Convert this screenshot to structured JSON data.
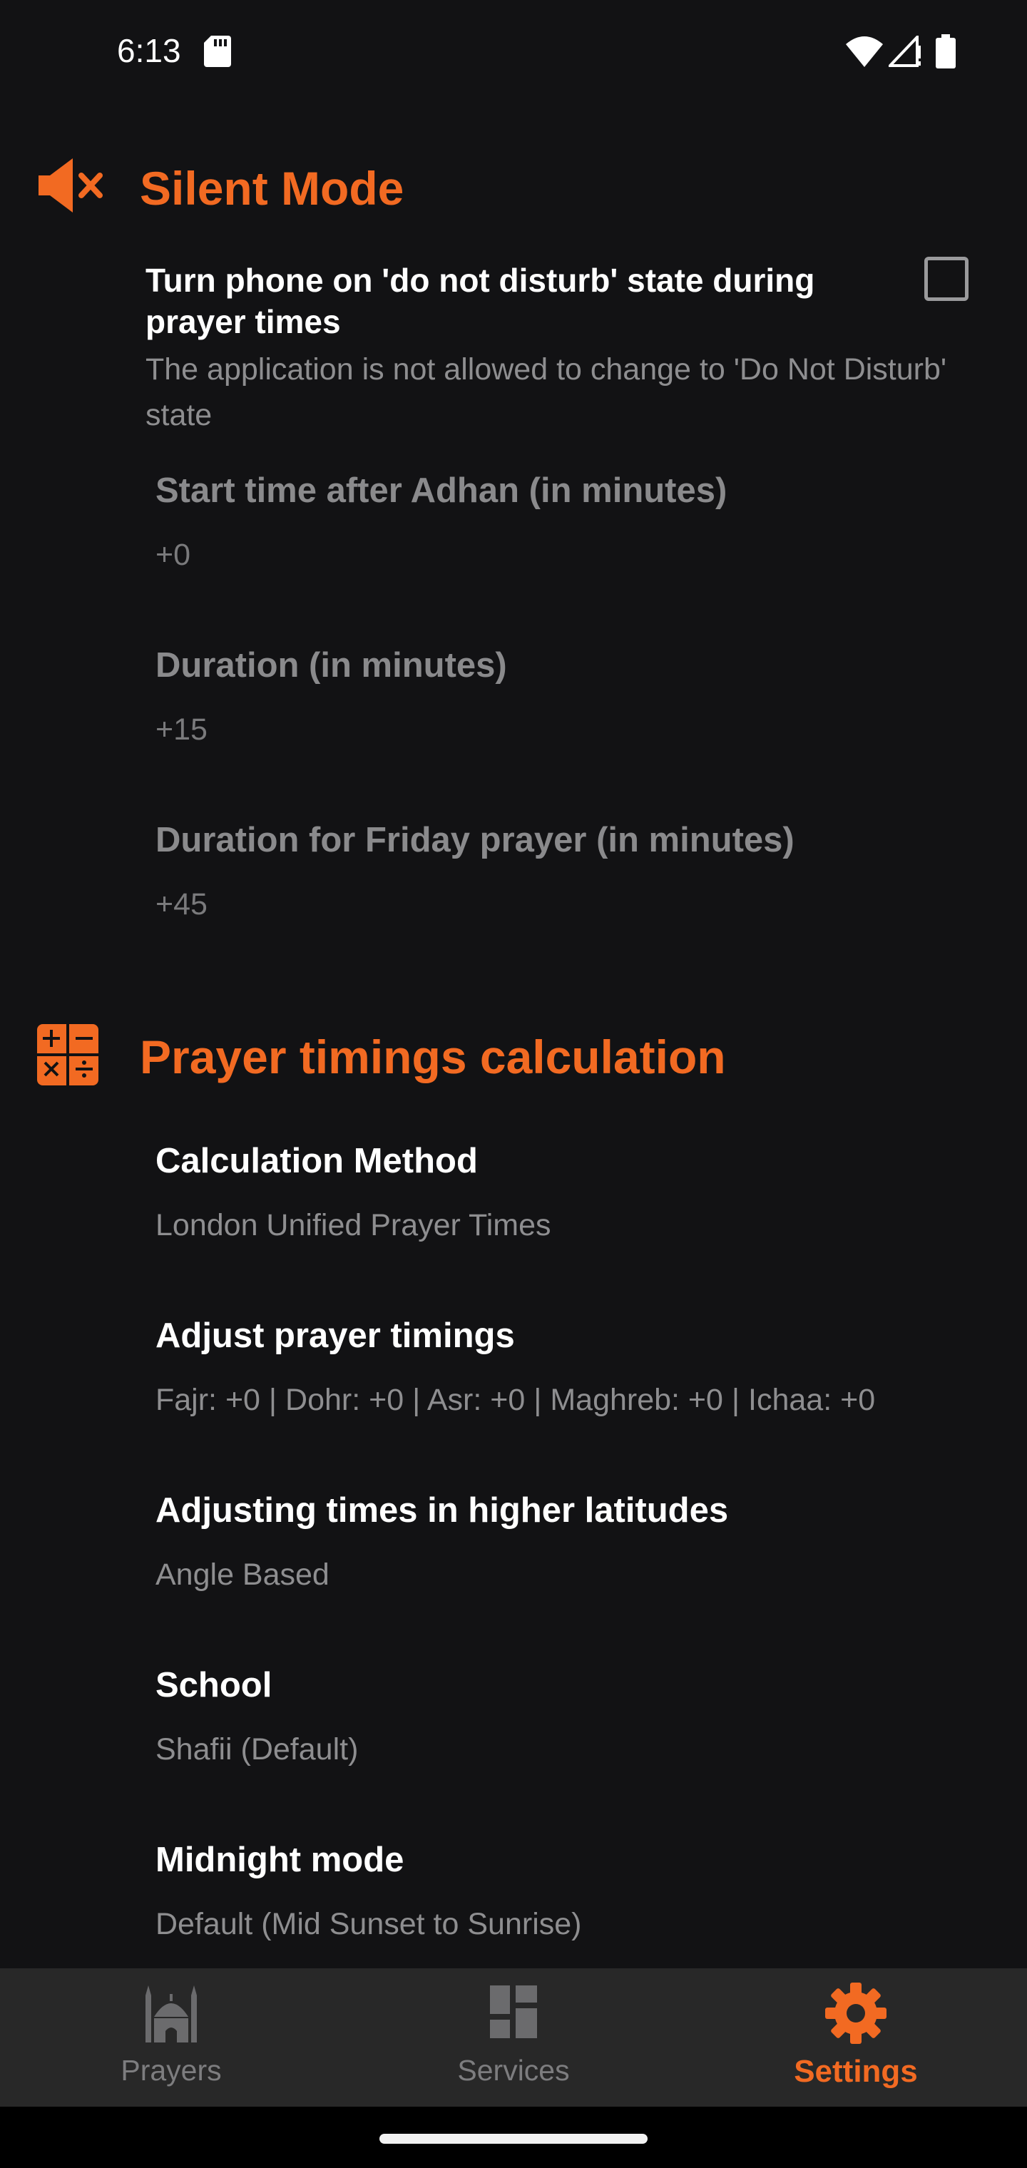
{
  "status_bar": {
    "time": "6:13",
    "icons": [
      "sd-card-icon",
      "wifi-icon",
      "signal-icon",
      "battery-icon"
    ]
  },
  "colors": {
    "accent": "#f26a22",
    "background": "#121214",
    "nav_background": "#282828",
    "disabled_text": "#8a8a8c"
  },
  "silent_mode": {
    "icon": "volume-off-icon",
    "title": "Silent Mode",
    "dnd_toggle": {
      "title": "Turn phone on 'do not disturb' state during prayer times",
      "summary": "The application is not allowed to change to 'Do Not Disturb' state",
      "checked": false
    },
    "items": [
      {
        "title": "Start time after Adhan (in minutes)",
        "value": "+0"
      },
      {
        "title": "Duration (in minutes)",
        "value": "+15"
      },
      {
        "title": "Duration for Friday prayer (in minutes)",
        "value": "+45"
      }
    ]
  },
  "calculation": {
    "icon": "calculator-icon",
    "title": "Prayer timings calculation",
    "items": [
      {
        "title": "Calculation Method",
        "value": "London Unified Prayer Times"
      },
      {
        "title": "Adjust prayer timings",
        "value": "Fajr: +0 | Dohr: +0 | Asr: +0 | Maghreb: +0 | Ichaa: +0"
      },
      {
        "title": "Adjusting times in higher latitudes",
        "value": "Angle Based"
      },
      {
        "title": "School",
        "value": "Shafii (Default)"
      },
      {
        "title": "Midnight mode",
        "value": "Default (Mid Sunset to Sunrise)"
      }
    ]
  },
  "bottom_nav": {
    "items": [
      {
        "label": "Prayers",
        "icon": "mosque-icon",
        "active": false
      },
      {
        "label": "Services",
        "icon": "dashboard-icon",
        "active": false
      },
      {
        "label": "Settings",
        "icon": "gear-icon",
        "active": true
      }
    ]
  }
}
